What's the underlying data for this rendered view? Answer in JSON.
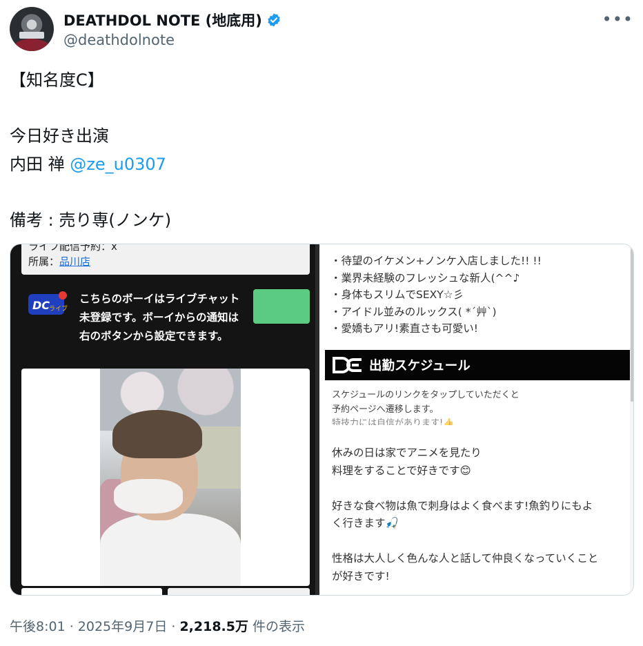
{
  "tweet": {
    "display_name": "DEATHDOL NOTE (地底用)",
    "handle": "@deathdolnote",
    "more_icon": "more-horizontal-icon",
    "text": {
      "line1": "【知名度C】",
      "line3": "今日好き出演",
      "line4_name": "内田 禅",
      "line4_mention": "@ze_u0307",
      "line6": "備考 : 売り専(ノンケ)"
    },
    "footer": {
      "time": "午後8:01",
      "sep1": " · ",
      "date": "2025年9月7日",
      "sep2": " · ",
      "views": "2,218.5万",
      "views_label": " 件の表示"
    }
  },
  "image": {
    "left": {
      "info_line1": "ライフ配信予約：x",
      "info_label": "所属：",
      "info_link": "品川店",
      "live_text": "こちらのボーイはライブチャット未登録です。ボーイからの通知は右のボタンから設定できます。"
    },
    "right": {
      "bullets": [
        "・待望のイケメン+ノンケ入店しました!! !!",
        "・業界未経験のフレッシュな新人(^^♪",
        "・身体もスリムでSEXY☆彡",
        "・アイドル並みのルックス( *´艸`)",
        "・愛嬌もアリ!素直さも可愛い!"
      ],
      "schedule_title": "出勤スケジュール",
      "notice_line1": "スケジュールのリンクをタップしていただくと",
      "notice_line2": "予約ページへ遷移します。",
      "cut_line": "特技力には自信があります!👍",
      "profile": [
        "休みの日は家でアニメを見たり",
        "料理をすることで好きです😊",
        "",
        "好きな食べ物は魚で刺身はよく食べます!魚釣りにもよ",
        "く行きます🎣",
        "",
        "性格は大人しく色んな人と話して仲良くなっていくこと",
        "が好きです!"
      ]
    }
  },
  "colors": {
    "accent": "#1d9bf0",
    "secondary_text": "#536471",
    "green_button": "#5acb81"
  }
}
